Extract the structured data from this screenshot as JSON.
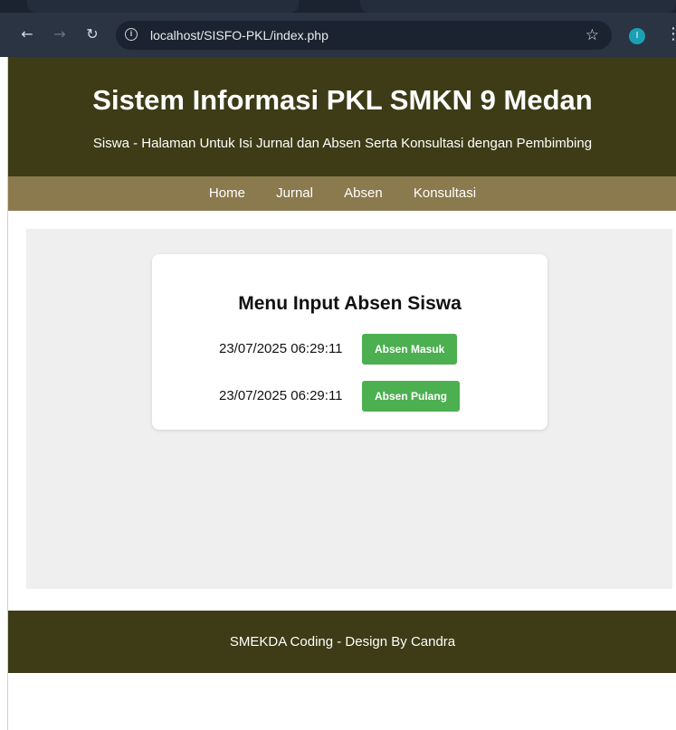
{
  "browser": {
    "url": "localhost/SISFO-PKL/index.php",
    "profile_initial": "I"
  },
  "header": {
    "title": "Sistem Informasi PKL SMKN 9 Medan",
    "subtitle": "Siswa - Halaman Untuk Isi Jurnal dan Absen Serta Konsultasi dengan Pembimbing"
  },
  "nav": {
    "items": [
      {
        "label": "Home"
      },
      {
        "label": "Jurnal"
      },
      {
        "label": "Absen"
      },
      {
        "label": "Konsultasi"
      }
    ]
  },
  "absen": {
    "title": "Menu Input Absen Siswa",
    "masuk": {
      "timestamp": "23/07/2025 06:29:11",
      "button_label": "Absen Masuk"
    },
    "pulang": {
      "timestamp": "23/07/2025 06:29:11",
      "button_label": "Absen Pulang"
    }
  },
  "footer": {
    "text": "SMEKDA Coding - Design By Candra"
  },
  "colors": {
    "header_bg": "#3d3c16",
    "nav_bg": "#8b7a4e",
    "button_bg": "#4caf50"
  }
}
